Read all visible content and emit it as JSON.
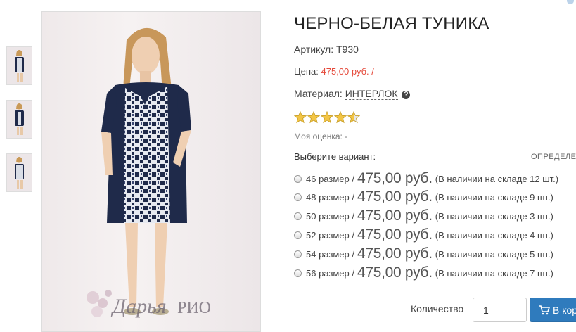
{
  "product": {
    "title": "ЧЕРНО-БЕЛАЯ ТУНИКА",
    "sku_label": "Артикул:",
    "sku_value": "T930",
    "price_label": "Цена:",
    "price_value": "475,00 руб.",
    "price_suffix": "/",
    "material_label": "Материал:",
    "material_value": "ИНТЕРЛОК",
    "help_glyph": "?",
    "rating": 4.5,
    "rating_max": 5,
    "my_rating_label": "Моя оценка:",
    "my_rating_value": "-"
  },
  "variants_section": {
    "choose_label": "Выберите вариант:",
    "defined_link": "ОПРЕДЕЛЕН",
    "items": [
      {
        "size": "46 размер /",
        "price": "475,00 руб.",
        "stock": "(В наличии на складе 12 шт.)"
      },
      {
        "size": "48 размер /",
        "price": "475,00 руб.",
        "stock": "(В наличии на складе 9 шт.)"
      },
      {
        "size": "50 размер /",
        "price": "475,00 руб.",
        "stock": "(В наличии на складе 3 шт.)"
      },
      {
        "size": "52 размер /",
        "price": "475,00 руб.",
        "stock": "(В наличии на складе 4 шт.)"
      },
      {
        "size": "54 размер /",
        "price": "475,00 руб.",
        "stock": "(В наличии на складе 5 шт.)"
      },
      {
        "size": "56 размер /",
        "price": "475,00 руб.",
        "stock": "(В наличии на складе 7 шт.)"
      }
    ]
  },
  "purchase": {
    "quantity_label": "Количество",
    "quantity_value": "1",
    "cart_button_label": "В кор"
  },
  "watermark": {
    "text_script": "Дарья",
    "text_caps": "РИО"
  },
  "colors": {
    "price_red": "#e5493a",
    "button_blue": "#2f7bbd",
    "star_gold": "#f3c545",
    "dress_navy": "#1f2a4a"
  },
  "icons": {
    "cart": "cart-icon",
    "help": "question-circle-icon",
    "star": "star-icon"
  }
}
